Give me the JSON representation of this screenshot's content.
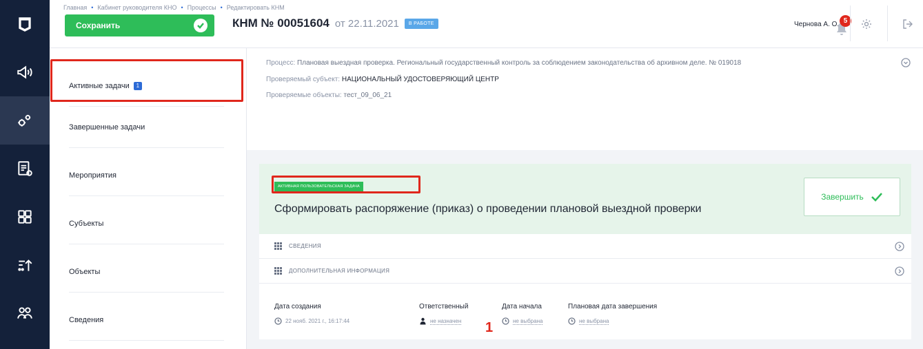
{
  "header": {
    "breadcrumb": [
      "Главная",
      "Кабинет руководителя КНО",
      "Процессы",
      "Редактировать КНМ"
    ],
    "save_label": "Сохранить",
    "doc_number": "КНМ № 00051604",
    "doc_date": "от 22.11.2021",
    "doc_status": "В РАБОТЕ",
    "user_name": "Чернова А. О.",
    "notifications_count": "5"
  },
  "nav": {
    "items": [
      {
        "label": "Активные задачи",
        "count": "1"
      },
      {
        "label": "Завершенные задачи"
      },
      {
        "label": "Мероприятия"
      },
      {
        "label": "Субъекты"
      },
      {
        "label": "Объекты"
      },
      {
        "label": "Сведения"
      }
    ]
  },
  "process": {
    "process_label": "Процесс:",
    "process_value": "Плановая выездная проверка. Региональный государственный контроль за соблюдением законодательства об архивном деле. № 019018",
    "subject_label": "Проверяемый субъект:",
    "subject_value": "НАЦИОНАЛЬНЫЙ УДОСТОВЕРЯЮЩИЙ ЦЕНТР",
    "objects_label": "Проверяемые объекты:",
    "objects_value": "тест_09_06_21"
  },
  "task": {
    "tag": "АКТИВНАЯ ПОЛЬЗОВАТЕЛЬСКАЯ ЗАДАЧА",
    "title": "Сформировать распоряжение (приказ) о проведении плановой выездной проверки",
    "finish_label": "Завершить",
    "sections": [
      "СВЕДЕНИЯ",
      "ДОПОЛНИТЕЛЬНАЯ ИНФОРМАЦИЯ"
    ],
    "meta": {
      "created_label": "Дата создания",
      "created_value": "22 нояб. 2021 г., 16:17:44",
      "responsible_label": "Ответственный",
      "responsible_value": "не назначен",
      "start_label": "Дата начала",
      "start_value": "не выбрана",
      "planned_end_label": "Плановая дата завершения",
      "planned_end_value": "не выбрана"
    }
  },
  "annotation": {
    "marker": "1"
  },
  "colors": {
    "accent_green": "#2ebd59",
    "highlight_red": "#e0271c",
    "rail_dark": "#14213a",
    "link_blue": "#2d6bd6"
  }
}
